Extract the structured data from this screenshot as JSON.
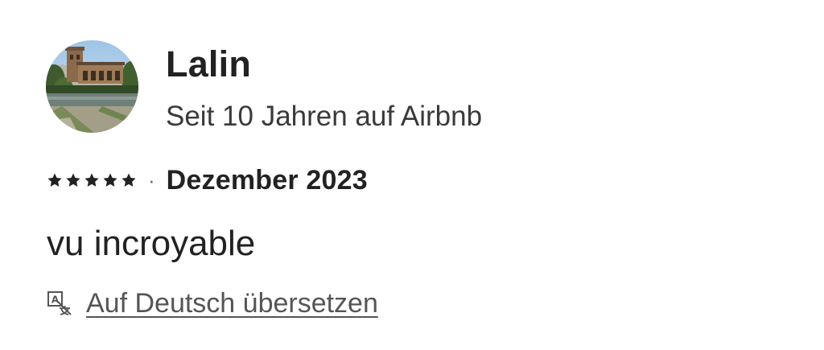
{
  "reviewer": {
    "name": "Lalin",
    "tenure": "Seit 10 Jahren auf Airbnb",
    "avatar_icon": "avatar-photo-castle"
  },
  "review": {
    "rating": 5,
    "rating_max": 5,
    "star_icon": "star-icon",
    "separator": "·",
    "date": "Dezember 2023",
    "text": "vu incroyable"
  },
  "translate": {
    "icon": "translate-icon",
    "link_label": "Auf Deutsch übersetzen"
  },
  "colors": {
    "text": "#222222",
    "secondary": "#3a3a3a",
    "link": "#555555"
  }
}
